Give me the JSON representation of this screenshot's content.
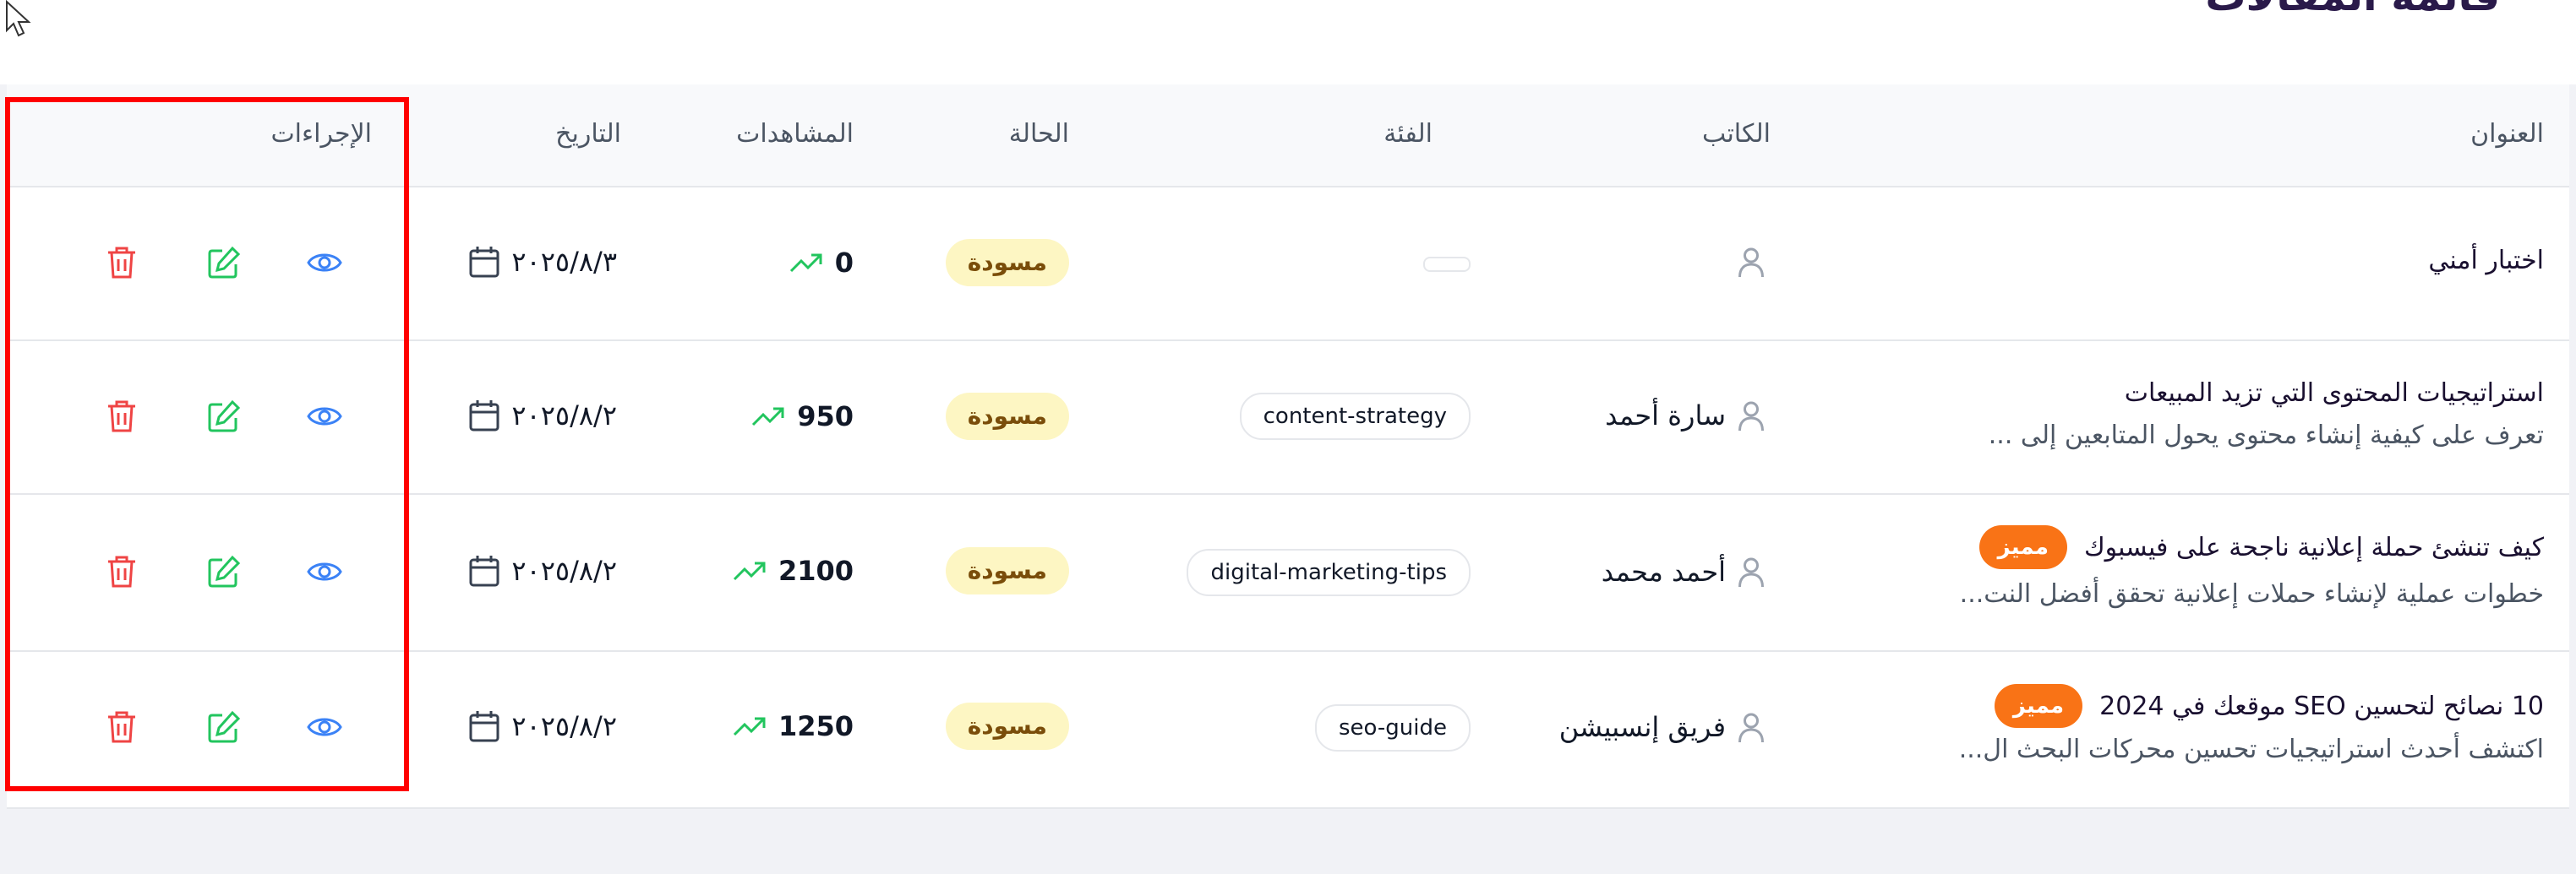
{
  "page": {
    "title": "قائمة المقالات"
  },
  "table": {
    "headers": {
      "title": "العنوان",
      "author": "الكاتب",
      "category": "الفئة",
      "status": "الحالة",
      "views": "المشاهدات",
      "date": "التاريخ",
      "actions": "الإجراءات"
    },
    "rows": [
      {
        "title": "اختبار أمني",
        "excerpt": "",
        "featured": "",
        "author": "",
        "category": "",
        "status": "مسودة",
        "views": "0",
        "date": "٢٠٢٥/٨/٣"
      },
      {
        "title": "استراتيجيات المحتوى التي تزيد المبيعات",
        "excerpt": "تعرف على كيفية إنشاء محتوى يحول المتابعين إلى ...",
        "featured": "",
        "author": "سارة أحمد",
        "category": "content-strategy",
        "status": "مسودة",
        "views": "950",
        "date": "٢٠٢٥/٨/٢"
      },
      {
        "title": "كيف تنشئ حملة إعلانية ناجحة على فيسبوك",
        "excerpt": "خطوات عملية لإنشاء حملات إعلانية تحقق أفضل النت...",
        "featured": "مميز",
        "author": "أحمد محمد",
        "category": "digital-marketing-tips",
        "status": "مسودة",
        "views": "2100",
        "date": "٢٠٢٥/٨/٢"
      },
      {
        "title": "10 نصائح لتحسين SEO موقعك في 2024",
        "excerpt": "اكتشف أحدث استراتيجيات تحسين محركات البحث ال...",
        "featured": "مميز",
        "author": "فريق إنسبيشن",
        "category": "seo-guide",
        "status": "مسودة",
        "views": "1250",
        "date": "٢٠٢٥/٨/٢"
      }
    ],
    "action_icons": [
      "eye-icon",
      "edit-icon",
      "trash-icon"
    ]
  },
  "colors": {
    "featured": "#f97316",
    "status_bg": "#fdf6c3",
    "status_text": "#7a4d0a",
    "view_icon": "#3b82f6",
    "edit_icon": "#22c55e",
    "delete_icon": "#ef4444",
    "trend_icon": "#22c55e",
    "highlight": "#ff0000"
  }
}
